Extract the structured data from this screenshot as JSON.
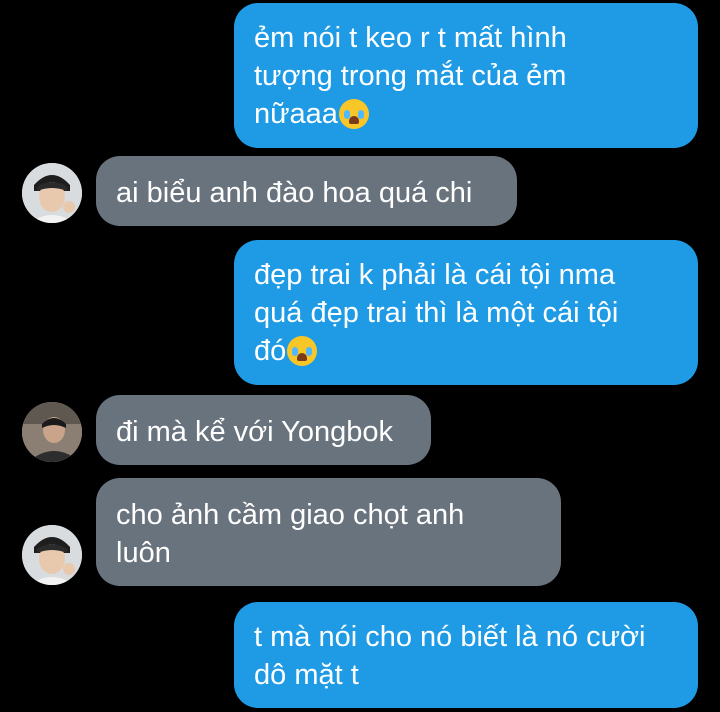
{
  "messages": [
    {
      "side": "sent",
      "text": "ẻm nói t keo r t mất hình\ntượng trong mắt của ẻm\nnữaaa",
      "emoji": "loudly-crying-face-emoji"
    },
    {
      "side": "received",
      "text": "ai biểu anh đào hoa quá chi",
      "avatar": "avatar-1"
    },
    {
      "side": "sent",
      "text": "đẹp trai k phải là cái tội nma\nquá đẹp trai thì là một cái tội\nđó",
      "emoji": "loudly-crying-face-emoji"
    },
    {
      "side": "received",
      "text": "đi mà kể với Yongbok",
      "avatar": "avatar-2"
    },
    {
      "side": "received",
      "text": "cho ảnh cầm giao chọt anh\nluôn",
      "avatar": "avatar-1"
    },
    {
      "side": "sent",
      "text": "t mà nói cho nó biết là nó cười\ndô mặt t"
    }
  ],
  "colors": {
    "sent": "#1f9be6",
    "received": "#69737d",
    "background": "#000000"
  }
}
